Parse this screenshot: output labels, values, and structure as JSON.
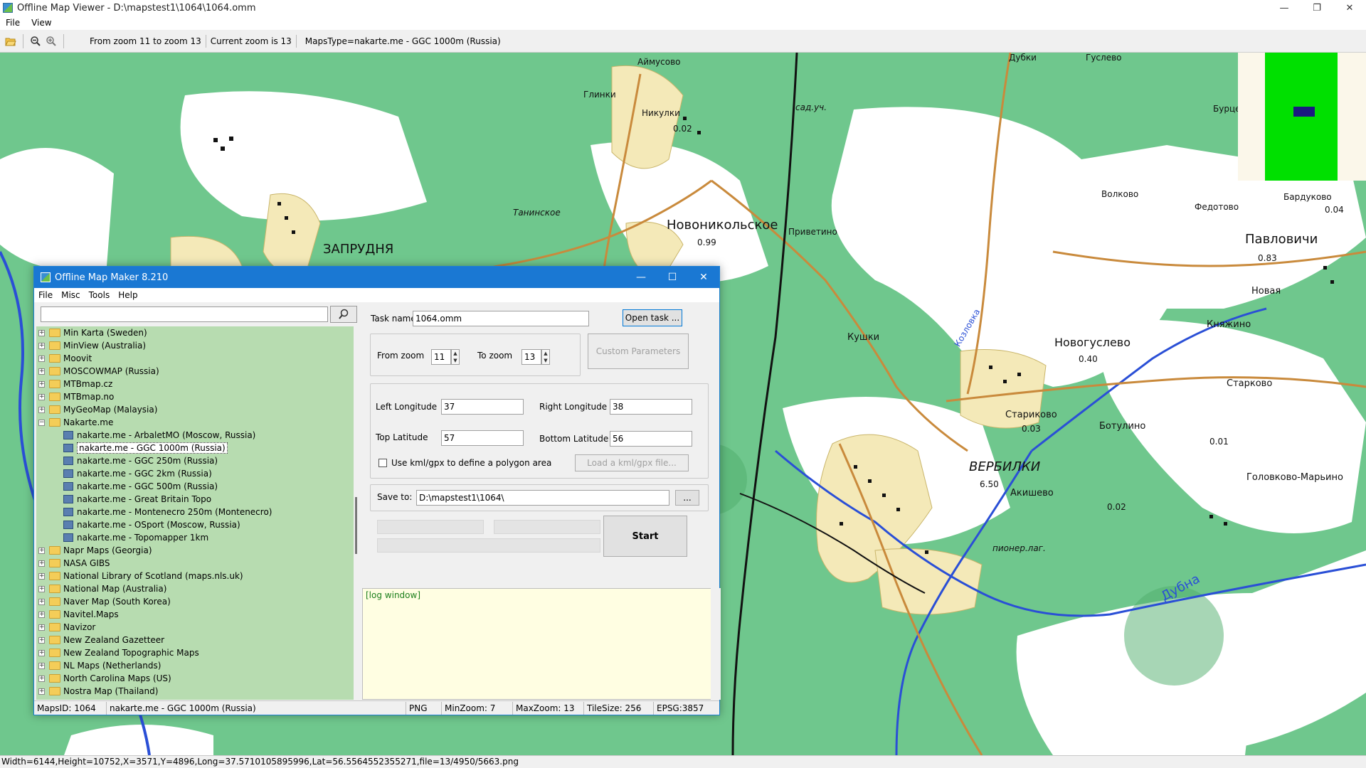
{
  "window": {
    "title": "Offline Map Viewer - D:\\mapstest1\\1064\\1064.omm",
    "controls": {
      "minimize": "—",
      "maximize": "❐",
      "close": "✕"
    }
  },
  "menu": [
    "File",
    "View"
  ],
  "toolbar": {
    "zoom_range": "From zoom 11 to zoom 13",
    "current_zoom": "Current zoom is 13",
    "maps_type": "MapsType=nakarte.me - GGC 1000m (Russia)"
  },
  "map": {
    "labels": [
      "Аймусово",
      "Глинки",
      "Никулки",
      "Дубки",
      "Гуслево",
      "Бурцево",
      "Новоникольское",
      "Танинское",
      "ЗАПРУДНЯ",
      "Павловичи",
      "Новогуслево",
      "Кушки",
      "Волково",
      "Федотово",
      "Бардуково",
      "Приветино",
      "Новая",
      "Княжино",
      "Старково",
      "Стариково",
      "Ботулино",
      "ВЕРБИЛКИ",
      "Акишево",
      "Головково-Марьино",
      "Дубна",
      "Козловка",
      "сад.уч.",
      "пионер.лаг.",
      "0.99",
      "0.40",
      "0.83",
      "0.04",
      "0.03",
      "6.50",
      "0.02",
      "0.01",
      "0.02"
    ],
    "colors": {
      "forest": "#6fc78d",
      "clearing": "#ffffff",
      "river": "#2a4fd6",
      "road": "#c98a3c",
      "railway": "#111111"
    }
  },
  "statusbar": {
    "text": "Width=6144,Height=10752,X=3571,Y=4896,Long=37.5710105895996,Lat=56.5564552355271,file=13/4950/5663.png"
  },
  "dialog": {
    "title": "Offline Map Maker 8.210",
    "menu": [
      "File",
      "Misc",
      "Tools",
      "Help"
    ],
    "tree": [
      {
        "label": "Min Karta (Sweden)",
        "type": "folder"
      },
      {
        "label": "MinView (Australia)",
        "type": "folder"
      },
      {
        "label": "Moovit",
        "type": "folder"
      },
      {
        "label": "MOSCOWMAP (Russia)",
        "type": "folder"
      },
      {
        "label": "MTBmap.cz",
        "type": "folder"
      },
      {
        "label": "MTBmap.no",
        "type": "folder"
      },
      {
        "label": "MyGeoMap (Malaysia)",
        "type": "folder"
      },
      {
        "label": "Nakarte.me",
        "type": "folder-open"
      },
      {
        "label": "nakarte.me - ArbaletMO (Moscow, Russia)",
        "type": "leaf"
      },
      {
        "label": "nakarte.me - GGC 1000m (Russia)",
        "type": "leaf",
        "selected": true
      },
      {
        "label": "nakarte.me - GGC 250m (Russia)",
        "type": "leaf"
      },
      {
        "label": "nakarte.me - GGC 2km (Russia)",
        "type": "leaf"
      },
      {
        "label": "nakarte.me - GGC 500m (Russia)",
        "type": "leaf"
      },
      {
        "label": "nakarte.me - Great Britain Topo",
        "type": "leaf"
      },
      {
        "label": "nakarte.me - Montenecro 250m (Montenecro)",
        "type": "leaf"
      },
      {
        "label": "nakarte.me - OSport (Moscow, Russia)",
        "type": "leaf"
      },
      {
        "label": "nakarte.me - Topomapper 1km",
        "type": "leaf"
      },
      {
        "label": "Napr Maps (Georgia)",
        "type": "folder"
      },
      {
        "label": "NASA GIBS",
        "type": "folder"
      },
      {
        "label": "National Library of Scotland (maps.nls.uk)",
        "type": "folder"
      },
      {
        "label": "National Map (Australia)",
        "type": "folder"
      },
      {
        "label": "Naver Map (South Korea)",
        "type": "folder"
      },
      {
        "label": "Navitel.Maps",
        "type": "folder"
      },
      {
        "label": "Navizor",
        "type": "folder"
      },
      {
        "label": "New Zealand Gazetteer",
        "type": "folder"
      },
      {
        "label": "New Zealand Topographic Maps",
        "type": "folder"
      },
      {
        "label": "NL Maps (Netherlands)",
        "type": "folder"
      },
      {
        "label": "North Carolina Maps (US)",
        "type": "folder"
      },
      {
        "label": "Nostra Map (Thailand)",
        "type": "folder"
      }
    ],
    "form": {
      "task_name_label": "Task name",
      "task_name_value": "1064.omm",
      "open_task_button": "Open task ...",
      "from_zoom_label": "From zoom",
      "from_zoom_value": "11",
      "to_zoom_label": "To zoom",
      "to_zoom_value": "13",
      "custom_params_button": "Custom Parameters",
      "left_longitude_label": "Left Longitude",
      "left_longitude_value": "37",
      "right_longitude_label": "Right Longitude",
      "right_longitude_value": "38",
      "top_latitude_label": "Top Latitude",
      "top_latitude_value": "57",
      "bottom_latitude_label": "Bottom Latitude",
      "bottom_latitude_value": "56",
      "kml_checkbox_label": "Use kml/gpx to define a polygon area",
      "load_kml_button": "Load a kml/gpx file...",
      "save_to_label": "Save to:",
      "save_to_value": "D:\\mapstest1\\1064\\",
      "browse_button": "...",
      "start_button": "Start",
      "log_text": "[log window]"
    },
    "status": {
      "maps_id": "MapsID: 1064",
      "map_name": "nakarte.me - GGC 1000m (Russia)",
      "format": "PNG",
      "min_zoom": "MinZoom: 7",
      "max_zoom": "MaxZoom: 13",
      "tile_size": "TileSize: 256",
      "epsg": "EPSG:3857"
    }
  }
}
